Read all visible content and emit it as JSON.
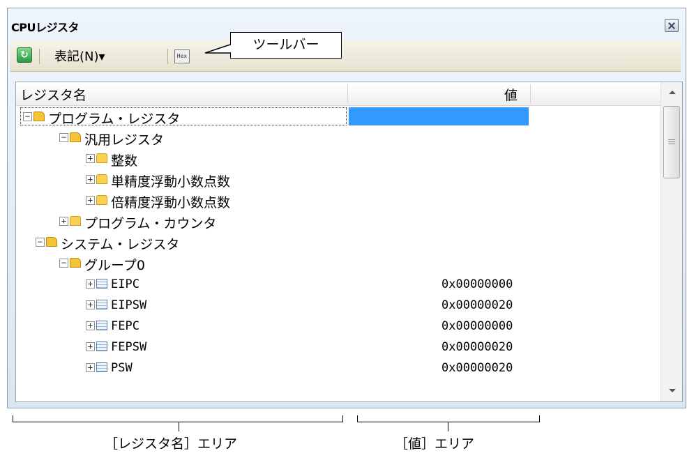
{
  "window": {
    "title": "CPUレジスタ"
  },
  "toolbar": {
    "notation_label": "表記(N)▾",
    "hex_label": "Hex"
  },
  "callout": {
    "toolbar_label": "ツールバー"
  },
  "table": {
    "col_name": "レジスタ名",
    "col_value": "値",
    "rows": [
      {
        "label": "プログラム・レジスタ",
        "value": ""
      },
      {
        "label": "汎用レジスタ",
        "value": ""
      },
      {
        "label": "整数",
        "value": ""
      },
      {
        "label": "単精度浮動小数点数",
        "value": ""
      },
      {
        "label": "倍精度浮動小数点数",
        "value": ""
      },
      {
        "label": "プログラム・カウンタ",
        "value": ""
      },
      {
        "label": "システム・レジスタ",
        "value": ""
      },
      {
        "label": "グループ0",
        "value": ""
      },
      {
        "label": "EIPC",
        "value": "0x00000000"
      },
      {
        "label": "EIPSW",
        "value": "0x00000020"
      },
      {
        "label": "FEPC",
        "value": "0x00000000"
      },
      {
        "label": "FEPSW",
        "value": "0x00000020"
      },
      {
        "label": "PSW",
        "value": "0x00000020"
      }
    ]
  },
  "annotations": {
    "name_area": "［レジスタ名］エリア",
    "value_area": "［値］エリア"
  },
  "colors": {
    "selection": "#3399ff"
  }
}
